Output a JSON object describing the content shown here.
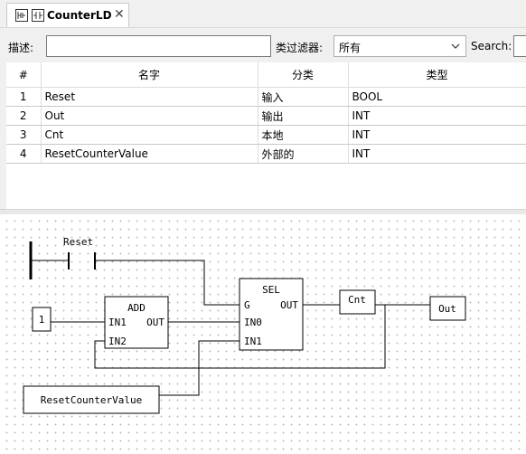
{
  "tab": {
    "title": "CounterLD",
    "close": "✕"
  },
  "filter": {
    "desc_label": "描述:",
    "desc_value": "",
    "class_filter_label": "类过滤器:",
    "class_filter_value": "所有",
    "search_label": "Search:",
    "search_value": ""
  },
  "table": {
    "columns": [
      "#",
      "名字",
      "分类",
      "类型"
    ],
    "rows": [
      {
        "num": "1",
        "name": "Reset",
        "class": "输入",
        "type": "BOOL"
      },
      {
        "num": "2",
        "name": "Out",
        "class": "输出",
        "type": "INT"
      },
      {
        "num": "3",
        "name": "Cnt",
        "class": "本地",
        "type": "INT"
      },
      {
        "num": "4",
        "name": "ResetCounterValue",
        "class": "外部的",
        "type": "INT"
      }
    ]
  },
  "diagram": {
    "contact_label": "Reset",
    "add_block": {
      "name": "ADD",
      "in1": "IN1",
      "in2": "IN2",
      "out": "OUT"
    },
    "sel_block": {
      "name": "SEL",
      "g": "G",
      "in0": "IN0",
      "in1": "IN1",
      "out": "OUT"
    },
    "const_one": "1",
    "var_cnt": "Cnt",
    "var_out": "Out",
    "var_reset_value": "ResetCounterValue"
  }
}
